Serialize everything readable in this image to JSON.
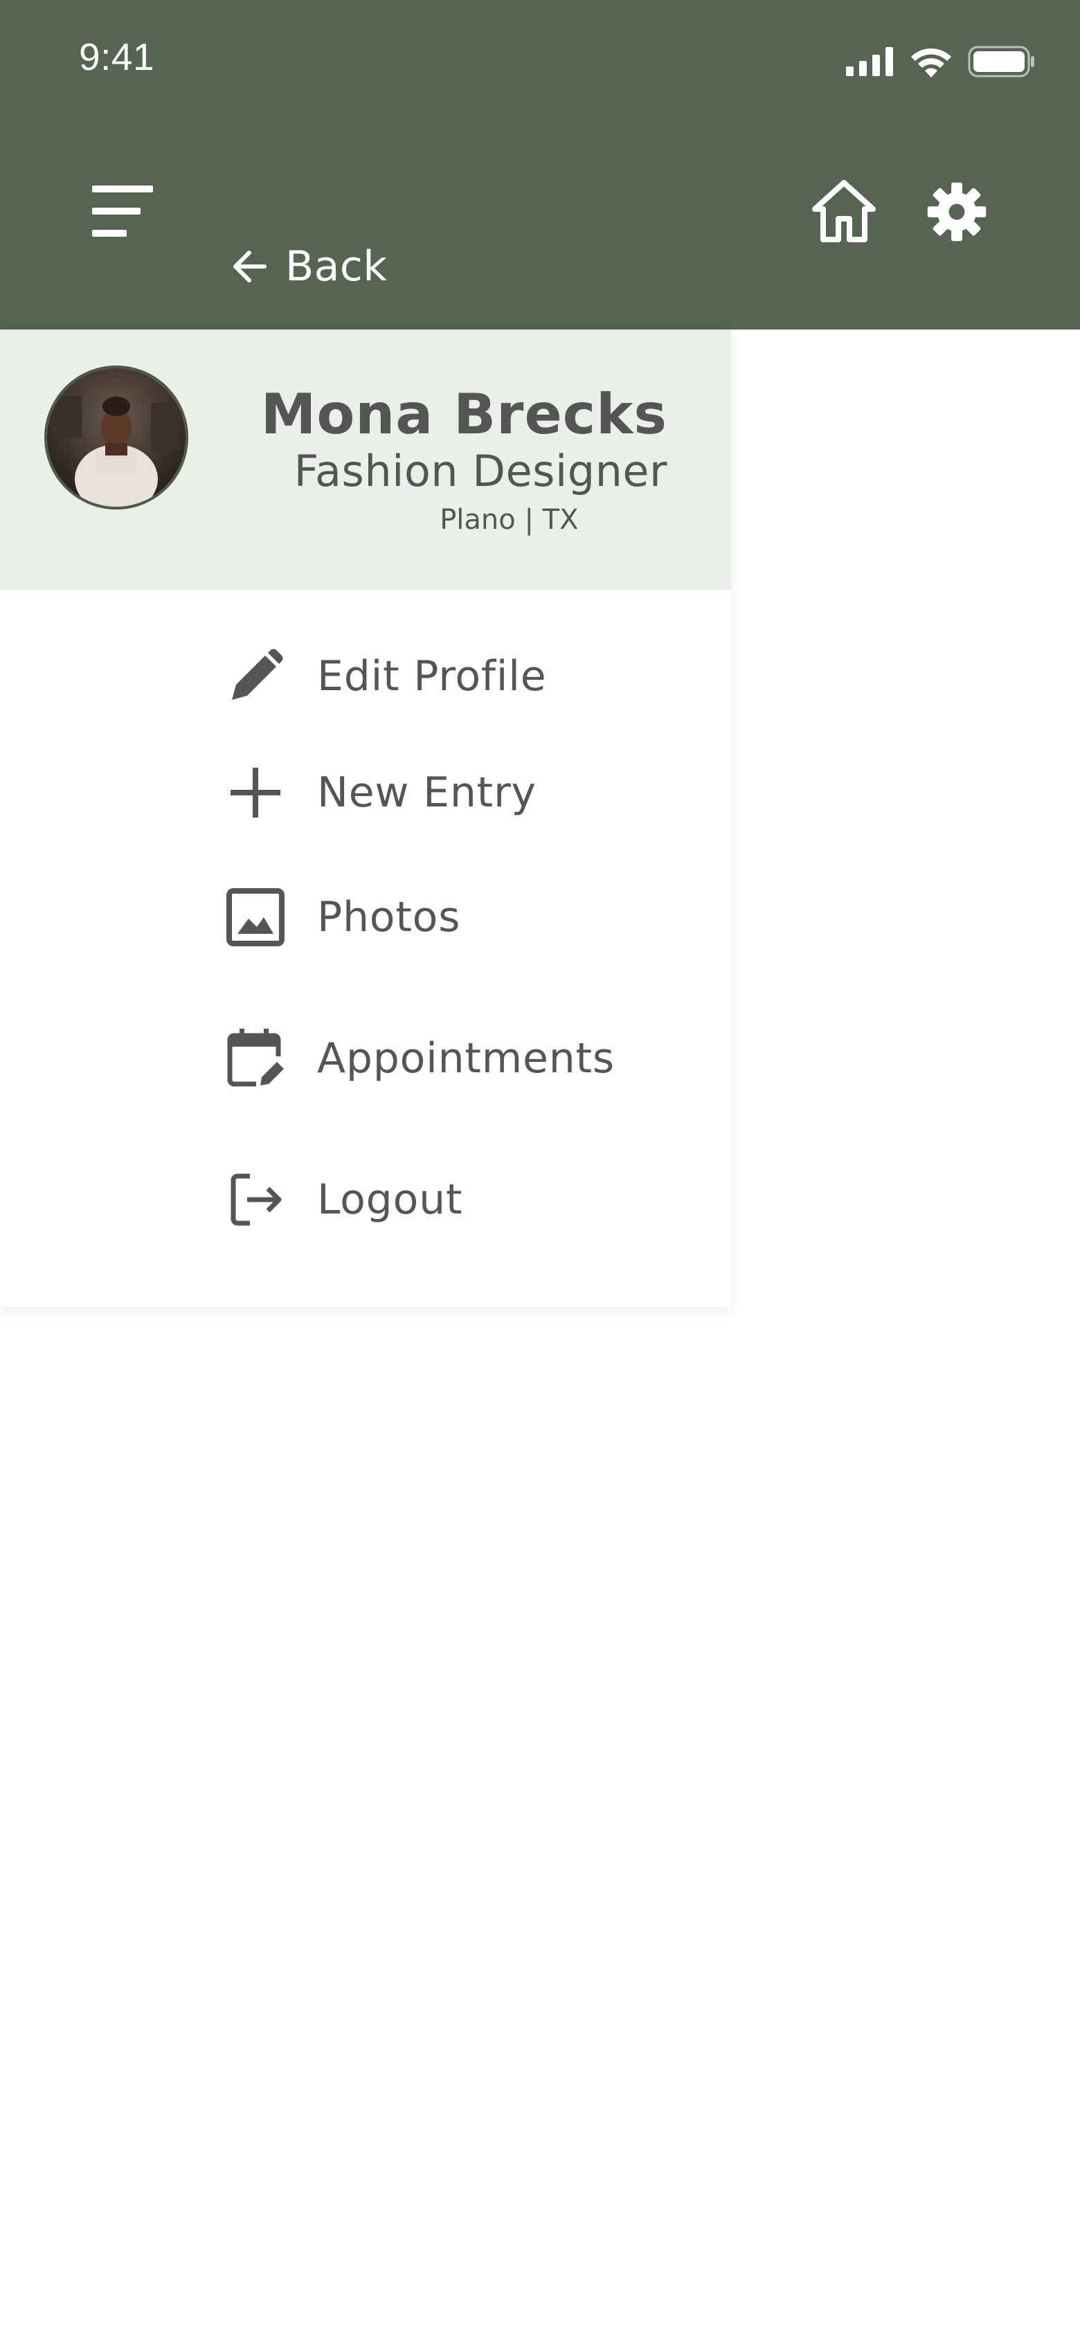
{
  "status_bar": {
    "time": "9:41"
  },
  "header": {
    "back_label": "Back",
    "icons": [
      "menu-icon",
      "back-arrow-icon",
      "home-icon",
      "gear-icon"
    ],
    "bg_color": "#566551"
  },
  "profile": {
    "name": "Mona Brecks",
    "role": "Fashion Designer",
    "location": "Plano | TX",
    "card_color": "#e8f0e8"
  },
  "menu": {
    "items": [
      {
        "label": "Edit Profile",
        "icon": "pencil-icon"
      },
      {
        "label": "New Entry",
        "icon": "plus-icon"
      },
      {
        "label": "Photos",
        "icon": "image-icon"
      },
      {
        "label": "Appointments",
        "icon": "calendar-edit-icon"
      },
      {
        "label": "Logout",
        "icon": "logout-icon"
      }
    ]
  }
}
